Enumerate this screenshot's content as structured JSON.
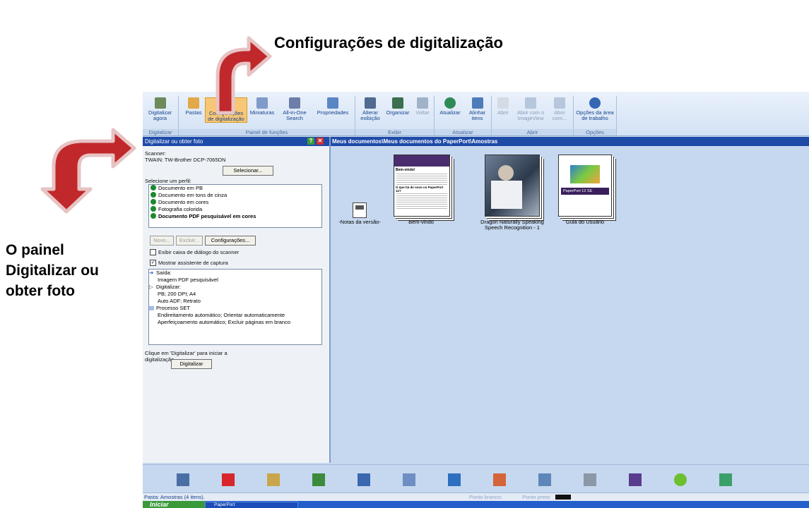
{
  "callouts": {
    "top": "Configurações de digitalização",
    "side_lines": [
      "O painel",
      "Digitalizar ou",
      "obter foto"
    ]
  },
  "ribbon": {
    "buttons": [
      {
        "label": "Digitalizar agora",
        "icon": "scanner-icon"
      },
      {
        "label": "Pastas",
        "icon": "folders-icon"
      },
      {
        "label": "Configurações de digitalização",
        "icon": "scan-settings-icon"
      },
      {
        "label": "Miniaturas",
        "icon": "thumbnails-icon"
      },
      {
        "label": "All-in-One Search",
        "icon": "search-icon"
      },
      {
        "label": "Propriedades",
        "icon": "properties-icon"
      },
      {
        "label": "Alterar exibição",
        "icon": "view-icon"
      },
      {
        "label": "Organizar",
        "icon": "organize-icon"
      },
      {
        "label": "Voltar",
        "icon": "back-icon"
      },
      {
        "label": "Atualizar",
        "icon": "refresh-icon"
      },
      {
        "label": "Alinhar itens",
        "icon": "align-icon"
      },
      {
        "label": "Abrir",
        "icon": "open-icon"
      },
      {
        "label": "Abrir com o ImageView",
        "icon": "imageview-icon"
      },
      {
        "label": "Abrir com...",
        "icon": "open-with-icon"
      },
      {
        "label": "Opções da área de trabalho",
        "icon": "desktop-options-icon"
      }
    ],
    "groups": [
      "Digitalizar",
      "Painel de funções",
      "Exibir",
      "Atualizar",
      "Abrir",
      "Opções"
    ]
  },
  "scan_panel": {
    "title": "Digitalizar ou obter foto",
    "scanner_label": "Scanner:",
    "scanner_value": "TWAIN: TW-Brother DCP-7065DN",
    "select_button": "Selecionar...",
    "profile_label": "Selecione um perfil:",
    "profiles": [
      "Documento em PB",
      "Documento em tons de cinza",
      "Documento em cores",
      "Fotografia colorida",
      "Documento PDF pesquisável em cores"
    ],
    "new_button": "Novo...",
    "delete_button": "Excluir...",
    "settings_button": "Configurações...",
    "show_dialog_label": "Exibir caixa de diálogo do scanner",
    "show_dialog_checked": false,
    "capture_assistant_label": "Mostrar assistente de captura",
    "capture_assistant_checked": true,
    "summary": [
      {
        "text": "Saída:",
        "icon": "output-icon"
      },
      {
        "text": "Imagem PDF pesquisável",
        "icon": ""
      },
      {
        "text": "Digitalizar:",
        "icon": "scan-icon"
      },
      {
        "text": "PB; 200 DPI; A4",
        "icon": ""
      },
      {
        "text": "Auto ADF; Retrato",
        "icon": ""
      },
      {
        "text": "Processo SET",
        "icon": "process-icon"
      },
      {
        "text": "Endireitamento automático; Orientar automaticamente",
        "icon": ""
      },
      {
        "text": "Aperfeiçoamento automático; Excluir páginas em branco",
        "icon": ""
      }
    ],
    "hint_line1": "Clique em 'Digitalizar' para iniciar a",
    "hint_line2": "digitalização.",
    "scan_button": "Digitalizar"
  },
  "documents": {
    "path": "Meus documentos\\Meus documentos do PaperPort\\Amostras",
    "items": [
      {
        "label": "-Notas da versão-"
      },
      {
        "label": "Bem-vindo",
        "doc_heading": "Bem-vindo!",
        "doc_subheading": "O que há de novo no PaperPort 12?"
      },
      {
        "label_line1": "Dragon Naturally Speaking",
        "label_line2": "Speech Recognition - 1"
      },
      {
        "label": "Guia do Usuário",
        "cover_text": "PaperPort 12 SE"
      }
    ]
  },
  "taskbar_icons": [
    "scanner-app-icon",
    "pdf-icon",
    "paint-icon",
    "excel-icon",
    "word-icon",
    "notepad-icon",
    "image-icon",
    "powerpoint-icon",
    "ftp-icon",
    "printer-icon",
    "people-icon",
    "green-app-icon",
    "recycle-icon"
  ],
  "status": {
    "folder": "Pasta: Amostras (4 itens).",
    "white_point": "Ponto branco:",
    "black_point": "Ponto preto:"
  },
  "os_taskbar": {
    "start": "Iniciar",
    "app": "PaperPort"
  },
  "colors": {
    "title_bar": "#1e4aa8",
    "arrow_red": "#c0282b",
    "active_button": "#f7c775"
  }
}
